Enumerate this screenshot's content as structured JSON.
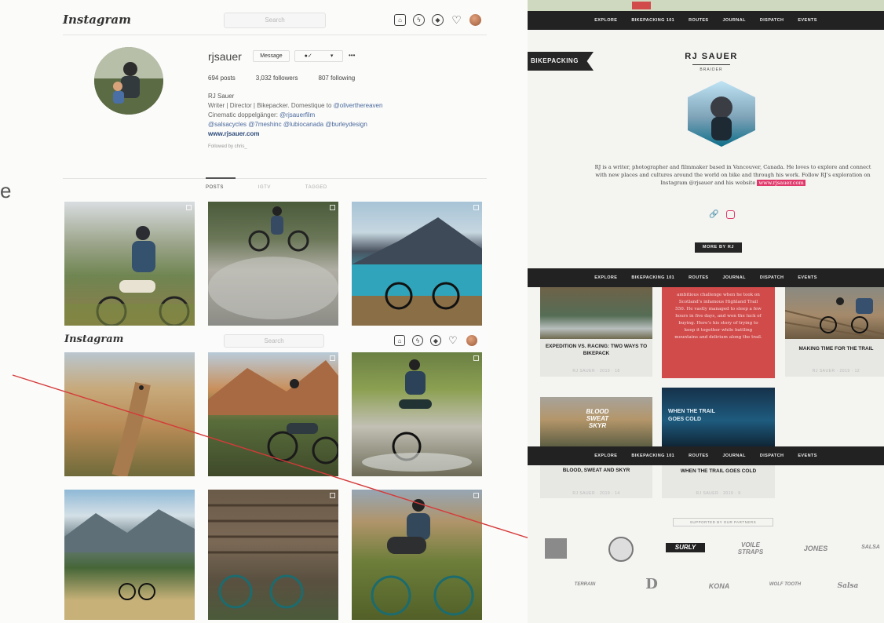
{
  "instagram": {
    "logo": "Instagram",
    "search_placeholder": "Search",
    "username": "rjsauer",
    "message_button": "Message",
    "follow_arrow": "▾",
    "more_button": "•••",
    "stats": {
      "posts": "694 posts",
      "followers": "3,032 followers",
      "following": "807 following"
    },
    "bio": {
      "name": "RJ Sauer",
      "line1_prefix": "Writer | Director | Bikepacker. Domestique to ",
      "line1_link": "@oliverthereaven",
      "line2_prefix": "Cinematic doppelgänger: ",
      "line2_link": "@rjsauerfilm",
      "line3": "@salsacycles @7meshinc @lubiocanada @burleydesign",
      "website": "www.rjsauer.com",
      "followed_by": "Followed by chris_"
    },
    "tabs": [
      "POSTS",
      "IGTV",
      "TAGGED"
    ],
    "overlay_logo": "Instagram",
    "overlay_search": "Search"
  },
  "annotation_letter": "e",
  "bikepacking": {
    "banner_badge": "",
    "nav_items": [
      "EXPLORE",
      "BIKEPACKING 101",
      "ROUTES",
      "JOURNAL",
      "DISPATCH",
      "EVENTS"
    ],
    "section_tag": "BIKEPACKING",
    "profile_name": "RJ SAUER",
    "profile_role": "BRAIDER",
    "bio": "RJ is a writer, photographer and filmmaker based in Vancouver, Canada. He loves to explore and connect with new places and cultures around the world on bike and through his work. Follow RJ’s exploration on Instagram @rjsauer and his website",
    "bio_link": "www.rjsauer.com",
    "more_by": "MORE BY RJ",
    "cards": [
      {
        "title": "EXPEDITION VS. RACING: TWO WAYS TO BIKEPACK",
        "meta": "RJ SAUER  ·  2019  ·  18"
      },
      {
        "title": "",
        "meta": ""
      },
      {
        "title": "MAKING TIME FOR THE TRAIL",
        "meta": "RJ SAUER  ·  2019  ·  12"
      },
      {
        "title": "BLOOD, SWEAT AND SKYR",
        "meta": "RJ SAUER  ·  2019  ·  14"
      },
      {
        "title": "WHEN THE TRAIL GOES COLD",
        "meta": "RJ SAUER  ·  2019  ·  9"
      }
    ],
    "red_card_text": "ambitious challenge when he took on Scotland’s infamous Highland Trail 550. He vastly managed to sleep a few hours in five days, and won the luck of buying. Here’s his story of trying to keep it together while battling mountains and delirium along the trail.",
    "thumb_text_1": "BLOOD SWEAT SKYR",
    "thumb_text_2": "WHEN THE TRAIL GOES COLD",
    "supported_by": "SUPPORTED BY OUR PARTNERS",
    "sponsors_row1": [
      "ADVENTURE CYCLING",
      "SURLY",
      "VOILE STRAPS",
      "JONES",
      "SALSA"
    ],
    "sponsors_row2": [
      "TERRAIN",
      "D",
      "KONA",
      "WOLF TOOTH",
      "Salsa"
    ]
  }
}
